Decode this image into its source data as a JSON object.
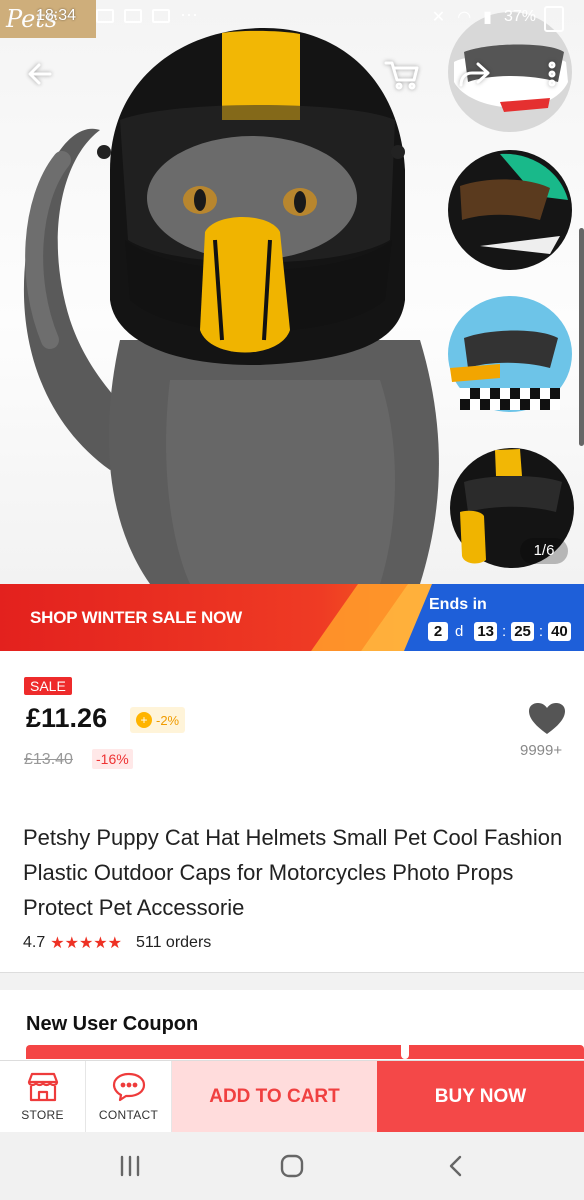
{
  "status_bar": {
    "brand": "Pets",
    "time": "18:34",
    "battery": "37%"
  },
  "gallery": {
    "page_indicator": "1/6",
    "thumbnails": [
      "helmet-white-red",
      "helmet-green-black",
      "helmet-blue-checker",
      "helmet-black-yellow"
    ]
  },
  "banner": {
    "text": "SHOP WINTER SALE NOW",
    "ends_label": "Ends in",
    "days": "2",
    "days_unit": "d",
    "hours": "13",
    "minutes": "25",
    "seconds": "40"
  },
  "price": {
    "sale_tag": "SALE",
    "current": "£11.26",
    "coin_discount": "-2%",
    "original": "£13.40",
    "discount": "-16%",
    "wishlist_count": "9999+"
  },
  "product": {
    "title": "Petshy Puppy Cat Hat Helmets Small Pet Cool Fashion Plastic Outdoor Caps for Motorcycles Photo Props Protect  Pet Accessorie",
    "rating": "4.7",
    "stars": "★★★★★",
    "orders": "511 orders"
  },
  "coupon": {
    "title": "New User Coupon"
  },
  "actions": {
    "store_label": "STORE",
    "contact_label": "CONTACT",
    "add_to_cart": "ADD TO CART",
    "buy_now": "BUY NOW"
  },
  "colors": {
    "accent_red": "#f44848",
    "banner_blue": "#1e5fd9",
    "sale_red": "#ee2b2b"
  }
}
